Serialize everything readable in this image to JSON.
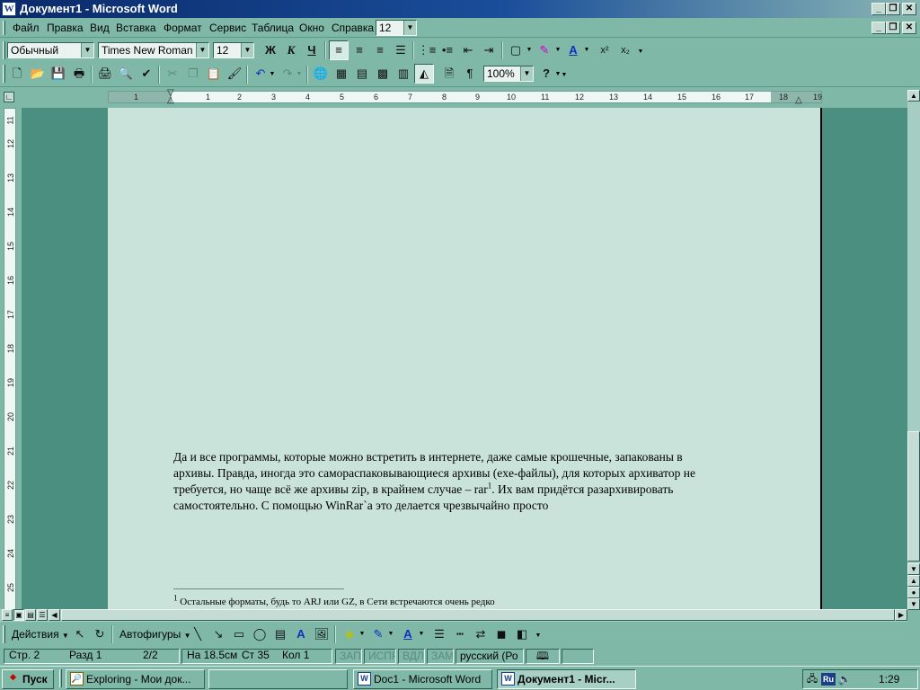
{
  "window": {
    "title": "Документ1 - Microsoft Word",
    "app_icon": "word-doc-icon"
  },
  "menu": [
    "Файл",
    "Правка",
    "Вид",
    "Вставка",
    "Формат",
    "Сервис",
    "Таблица",
    "Окно",
    "Справка"
  ],
  "menu_font_size": "12",
  "format_toolbar": {
    "style": "Обычный",
    "font": "Times New Roman",
    "size": "12",
    "bold": "Ж",
    "italic": "К",
    "underline": "Ч"
  },
  "standard_toolbar": {
    "zoom": "100%"
  },
  "ruler": {
    "h_ticks": [
      "1",
      "1",
      "2",
      "3",
      "4",
      "5",
      "6",
      "7",
      "8",
      "9",
      "10",
      "11",
      "12",
      "13",
      "14",
      "15",
      "16",
      "17",
      "18",
      "19"
    ],
    "v_ticks": [
      "11",
      "12",
      "13",
      "14",
      "15",
      "16",
      "17",
      "18",
      "19",
      "20",
      "21",
      "22",
      "23",
      "24",
      "25"
    ]
  },
  "document": {
    "paragraph_line1": "Да и все программы, которые можно встретить в  интернете, даже самые крошечные, запакованы в",
    "paragraph_line2": "архивы. Правда, иногда это самораспаковывающиеся архивы (exe-файлы), для которых архиватор не",
    "paragraph_line3a": "требуется, но чаще всё же архивы zip, в крайнем случае – rar",
    "footnote_ref": "1",
    "paragraph_line3b": ". Их вам придётся разархивировать",
    "paragraph_line4": "самостоятельно. С помощью WinRar`а это делается чрезвычайно просто",
    "footnote_num": "1",
    "footnote_text": " Остальные форматы, будь то ARJ или GZ, в Сети встречаются очень редко"
  },
  "drawing_toolbar": {
    "actions": "Действия",
    "autoshapes": "Автофигуры"
  },
  "status_bar": {
    "page": "Стр. 2",
    "section": "Разд 1",
    "pages": "2/2",
    "at": "На 18.5см",
    "line": "Ст 35",
    "col": "Кол 1",
    "rec": "ЗАП",
    "trk": "ИСПР",
    "ext": "ВДЛ",
    "ovr": "ЗАМ",
    "lang": "русский (Ро"
  },
  "taskbar": {
    "start": "Пуск",
    "tasks": [
      {
        "label": "Exploring - Мои док...",
        "active": false
      },
      {
        "label": "",
        "active": false
      },
      {
        "label": "Doc1 - Microsoft Word",
        "active": false
      },
      {
        "label": "Документ1 - Micr...",
        "active": true
      }
    ],
    "lang_indicator": "Ru",
    "clock": "1:29"
  },
  "colors": {
    "desktop": "#80b8a8",
    "workspace": "#4a8f80",
    "page": "#c9e2da",
    "title_start": "#0a2a6a"
  }
}
